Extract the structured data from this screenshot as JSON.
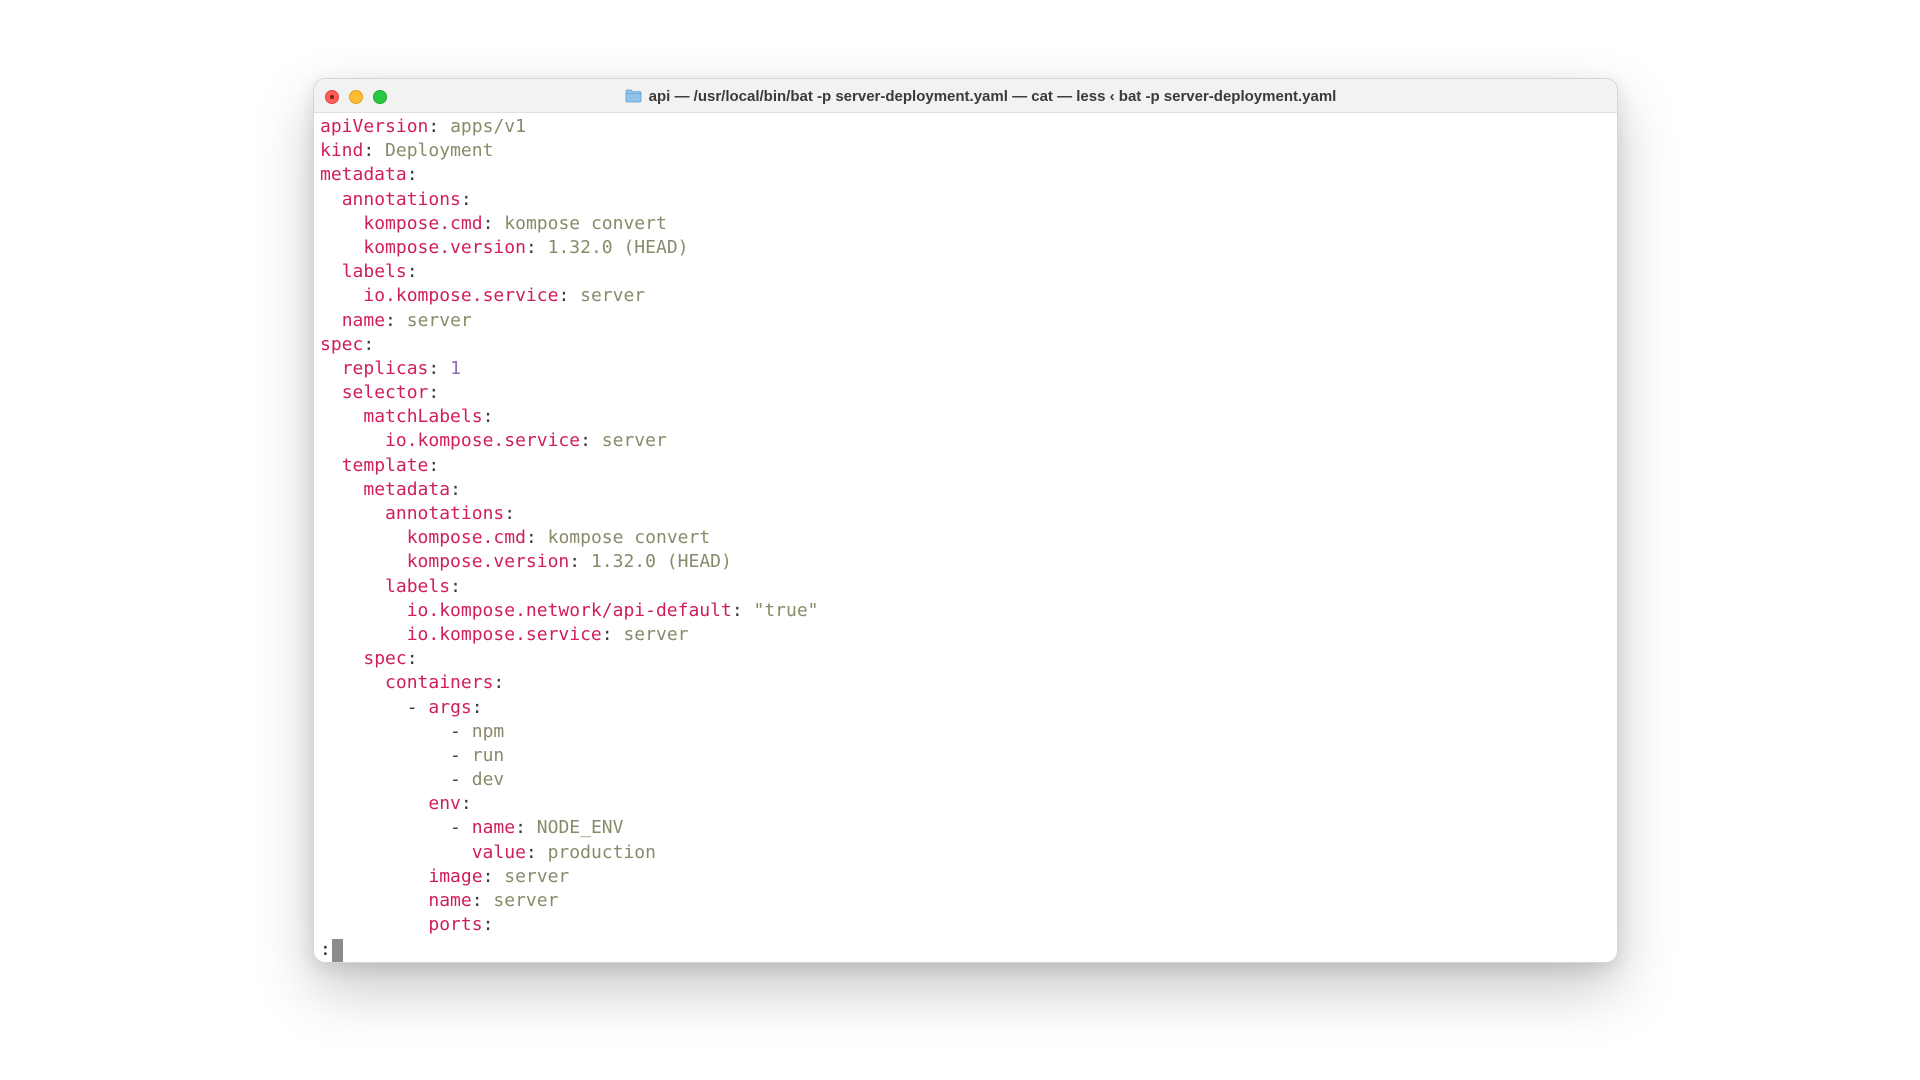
{
  "window": {
    "title": "api — /usr/local/bin/bat -p server-deployment.yaml — cat — less ‹ bat -p server-deployment.yaml",
    "folder_icon": "folder-icon",
    "buttons": [
      "close",
      "minimize",
      "zoom"
    ]
  },
  "colors": {
    "key": "#d01e5b",
    "value": "#8a8a6a",
    "number": "#8a6db5",
    "punct": "#3a3a3a"
  },
  "lines": [
    [
      {
        "t": "apiVersion",
        "c": "k"
      },
      {
        "t": ": ",
        "c": "p"
      },
      {
        "t": "apps/v1",
        "c": "v"
      }
    ],
    [
      {
        "t": "kind",
        "c": "k"
      },
      {
        "t": ": ",
        "c": "p"
      },
      {
        "t": "Deployment",
        "c": "v"
      }
    ],
    [
      {
        "t": "metadata",
        "c": "k"
      },
      {
        "t": ":",
        "c": "p"
      }
    ],
    [
      {
        "t": "  ",
        "c": "p"
      },
      {
        "t": "annotations",
        "c": "k"
      },
      {
        "t": ":",
        "c": "p"
      }
    ],
    [
      {
        "t": "    ",
        "c": "p"
      },
      {
        "t": "kompose.cmd",
        "c": "k"
      },
      {
        "t": ": ",
        "c": "p"
      },
      {
        "t": "kompose convert",
        "c": "v"
      }
    ],
    [
      {
        "t": "    ",
        "c": "p"
      },
      {
        "t": "kompose.version",
        "c": "k"
      },
      {
        "t": ": ",
        "c": "p"
      },
      {
        "t": "1.32.0 (HEAD)",
        "c": "v"
      }
    ],
    [
      {
        "t": "  ",
        "c": "p"
      },
      {
        "t": "labels",
        "c": "k"
      },
      {
        "t": ":",
        "c": "p"
      }
    ],
    [
      {
        "t": "    ",
        "c": "p"
      },
      {
        "t": "io.kompose.service",
        "c": "k"
      },
      {
        "t": ": ",
        "c": "p"
      },
      {
        "t": "server",
        "c": "v"
      }
    ],
    [
      {
        "t": "  ",
        "c": "p"
      },
      {
        "t": "name",
        "c": "k"
      },
      {
        "t": ": ",
        "c": "p"
      },
      {
        "t": "server",
        "c": "v"
      }
    ],
    [
      {
        "t": "spec",
        "c": "k"
      },
      {
        "t": ":",
        "c": "p"
      }
    ],
    [
      {
        "t": "  ",
        "c": "p"
      },
      {
        "t": "replicas",
        "c": "k"
      },
      {
        "t": ": ",
        "c": "p"
      },
      {
        "t": "1",
        "c": "n"
      }
    ],
    [
      {
        "t": "  ",
        "c": "p"
      },
      {
        "t": "selector",
        "c": "k"
      },
      {
        "t": ":",
        "c": "p"
      }
    ],
    [
      {
        "t": "    ",
        "c": "p"
      },
      {
        "t": "matchLabels",
        "c": "k"
      },
      {
        "t": ":",
        "c": "p"
      }
    ],
    [
      {
        "t": "      ",
        "c": "p"
      },
      {
        "t": "io.kompose.service",
        "c": "k"
      },
      {
        "t": ": ",
        "c": "p"
      },
      {
        "t": "server",
        "c": "v"
      }
    ],
    [
      {
        "t": "  ",
        "c": "p"
      },
      {
        "t": "template",
        "c": "k"
      },
      {
        "t": ":",
        "c": "p"
      }
    ],
    [
      {
        "t": "    ",
        "c": "p"
      },
      {
        "t": "metadata",
        "c": "k"
      },
      {
        "t": ":",
        "c": "p"
      }
    ],
    [
      {
        "t": "      ",
        "c": "p"
      },
      {
        "t": "annotations",
        "c": "k"
      },
      {
        "t": ":",
        "c": "p"
      }
    ],
    [
      {
        "t": "        ",
        "c": "p"
      },
      {
        "t": "kompose.cmd",
        "c": "k"
      },
      {
        "t": ": ",
        "c": "p"
      },
      {
        "t": "kompose convert",
        "c": "v"
      }
    ],
    [
      {
        "t": "        ",
        "c": "p"
      },
      {
        "t": "kompose.version",
        "c": "k"
      },
      {
        "t": ": ",
        "c": "p"
      },
      {
        "t": "1.32.0 (HEAD)",
        "c": "v"
      }
    ],
    [
      {
        "t": "      ",
        "c": "p"
      },
      {
        "t": "labels",
        "c": "k"
      },
      {
        "t": ":",
        "c": "p"
      }
    ],
    [
      {
        "t": "        ",
        "c": "p"
      },
      {
        "t": "io.kompose.network/api-default",
        "c": "k"
      },
      {
        "t": ": ",
        "c": "p"
      },
      {
        "t": "\"true\"",
        "c": "v"
      }
    ],
    [
      {
        "t": "        ",
        "c": "p"
      },
      {
        "t": "io.kompose.service",
        "c": "k"
      },
      {
        "t": ": ",
        "c": "p"
      },
      {
        "t": "server",
        "c": "v"
      }
    ],
    [
      {
        "t": "    ",
        "c": "p"
      },
      {
        "t": "spec",
        "c": "k"
      },
      {
        "t": ":",
        "c": "p"
      }
    ],
    [
      {
        "t": "      ",
        "c": "p"
      },
      {
        "t": "containers",
        "c": "k"
      },
      {
        "t": ":",
        "c": "p"
      }
    ],
    [
      {
        "t": "        ",
        "c": "p"
      },
      {
        "t": "- ",
        "c": "p"
      },
      {
        "t": "args",
        "c": "k"
      },
      {
        "t": ":",
        "c": "p"
      }
    ],
    [
      {
        "t": "            ",
        "c": "p"
      },
      {
        "t": "- ",
        "c": "p"
      },
      {
        "t": "npm",
        "c": "v"
      }
    ],
    [
      {
        "t": "            ",
        "c": "p"
      },
      {
        "t": "- ",
        "c": "p"
      },
      {
        "t": "run",
        "c": "v"
      }
    ],
    [
      {
        "t": "            ",
        "c": "p"
      },
      {
        "t": "- ",
        "c": "p"
      },
      {
        "t": "dev",
        "c": "v"
      }
    ],
    [
      {
        "t": "          ",
        "c": "p"
      },
      {
        "t": "env",
        "c": "k"
      },
      {
        "t": ":",
        "c": "p"
      }
    ],
    [
      {
        "t": "            ",
        "c": "p"
      },
      {
        "t": "- ",
        "c": "p"
      },
      {
        "t": "name",
        "c": "k"
      },
      {
        "t": ": ",
        "c": "p"
      },
      {
        "t": "NODE_ENV",
        "c": "v"
      }
    ],
    [
      {
        "t": "              ",
        "c": "p"
      },
      {
        "t": "value",
        "c": "k"
      },
      {
        "t": ": ",
        "c": "p"
      },
      {
        "t": "production",
        "c": "v"
      }
    ],
    [
      {
        "t": "          ",
        "c": "p"
      },
      {
        "t": "image",
        "c": "k"
      },
      {
        "t": ": ",
        "c": "p"
      },
      {
        "t": "server",
        "c": "v"
      }
    ],
    [
      {
        "t": "          ",
        "c": "p"
      },
      {
        "t": "name",
        "c": "k"
      },
      {
        "t": ": ",
        "c": "p"
      },
      {
        "t": "server",
        "c": "v"
      }
    ],
    [
      {
        "t": "          ",
        "c": "p"
      },
      {
        "t": "ports",
        "c": "k"
      },
      {
        "t": ":",
        "c": "p"
      }
    ]
  ],
  "prompt": {
    "text": ":"
  }
}
